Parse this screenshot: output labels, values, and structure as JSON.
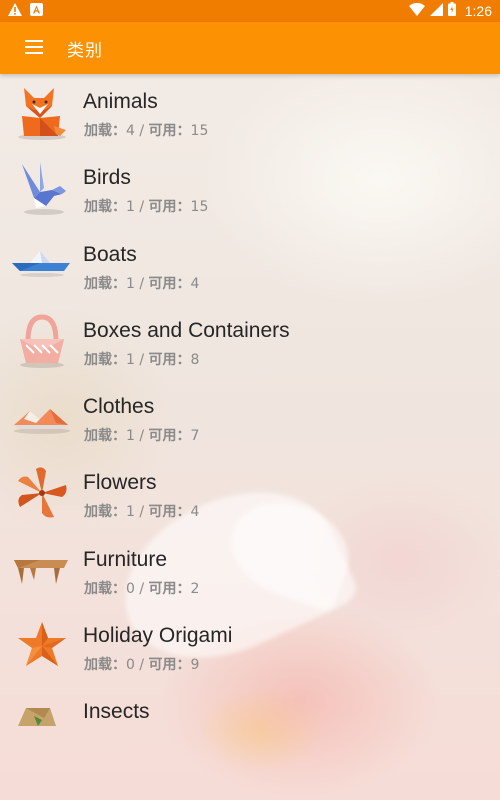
{
  "status_bar": {
    "time": "1:26",
    "left_icons": [
      "warning-icon",
      "app-notification-icon"
    ],
    "right_icons": [
      "wifi-icon",
      "cell-signal-icon",
      "battery-icon"
    ]
  },
  "app_bar": {
    "title": "类别",
    "menu_icon": "hamburger-menu-icon",
    "color": "#fd9104",
    "status_color": "#f07d00"
  },
  "sub_labels": {
    "loaded": "加载：",
    "separator": " / ",
    "available": "可用："
  },
  "categories": [
    {
      "name": "Animals",
      "loaded": "4",
      "available": "15",
      "icon": "fox-origami-icon"
    },
    {
      "name": "Birds",
      "loaded": "1",
      "available": "15",
      "icon": "bird-origami-icon"
    },
    {
      "name": "Boats",
      "loaded": "1",
      "available": "4",
      "icon": "boat-origami-icon"
    },
    {
      "name": "Boxes and Containers",
      "loaded": "1",
      "available": "8",
      "icon": "basket-origami-icon"
    },
    {
      "name": "Clothes",
      "loaded": "1",
      "available": "7",
      "icon": "hat-origami-icon"
    },
    {
      "name": "Flowers",
      "loaded": "1",
      "available": "4",
      "icon": "flower-origami-icon"
    },
    {
      "name": "Furniture",
      "loaded": "0",
      "available": "2",
      "icon": "table-origami-icon"
    },
    {
      "name": "Holiday Origami",
      "loaded": "0",
      "available": "9",
      "icon": "star-origami-icon"
    },
    {
      "name": "Insects",
      "loaded": "",
      "available": "",
      "icon": "insect-origami-icon"
    }
  ]
}
